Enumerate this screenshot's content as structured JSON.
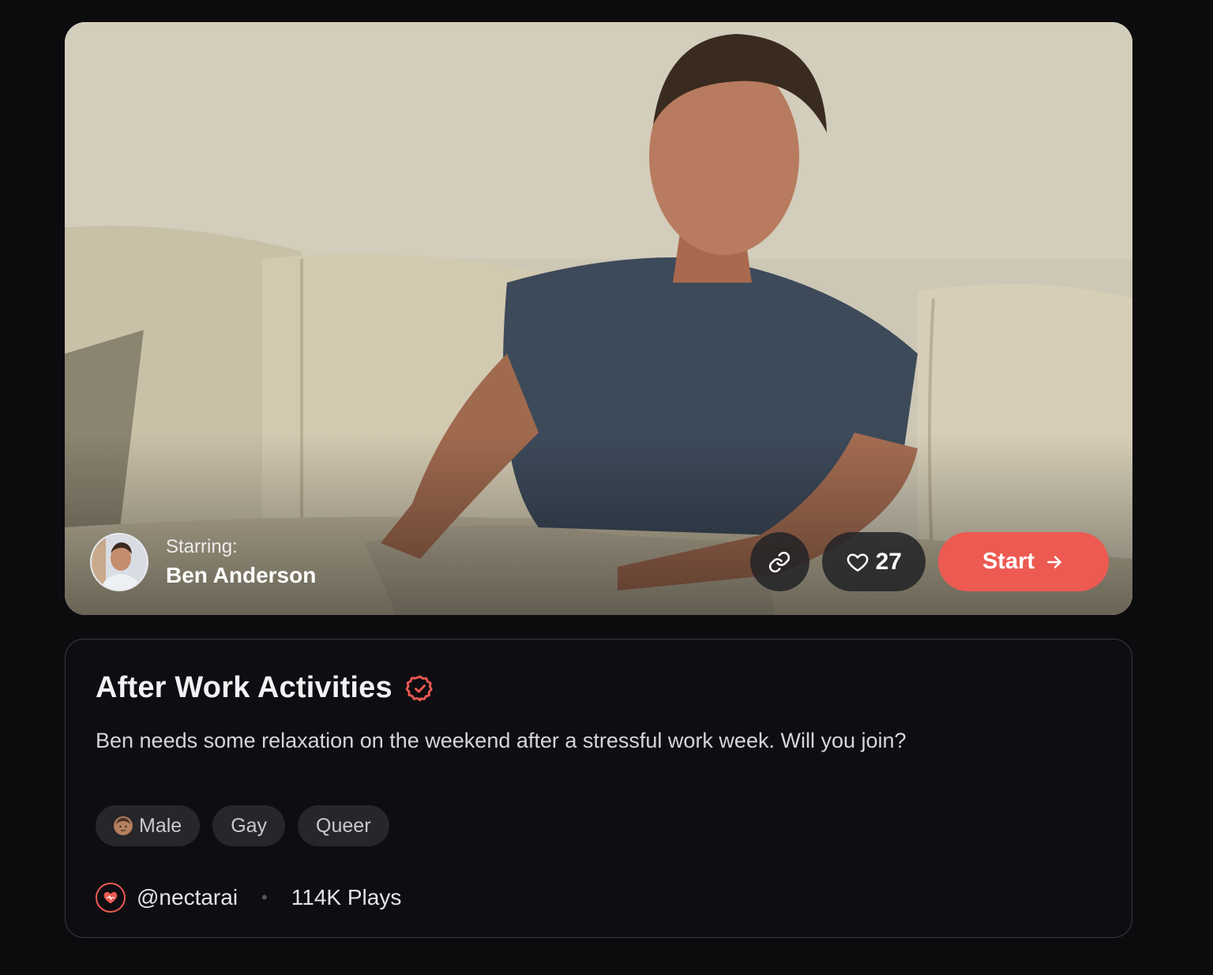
{
  "hero": {
    "starring_label": "Starring:",
    "character_name": "Ben Anderson",
    "likes": "27",
    "start_label": "Start",
    "accent_color": "#ec5a52"
  },
  "card": {
    "title": "After Work Activities",
    "description": "Ben needs some relaxation on the weekend after a stressful work week. Will you join?",
    "tags": [
      {
        "label": "Male",
        "icon": "man-emoji-icon"
      },
      {
        "label": "Gay"
      },
      {
        "label": "Queer"
      }
    ],
    "creator": "@nectarai",
    "plays": "114K Plays"
  }
}
